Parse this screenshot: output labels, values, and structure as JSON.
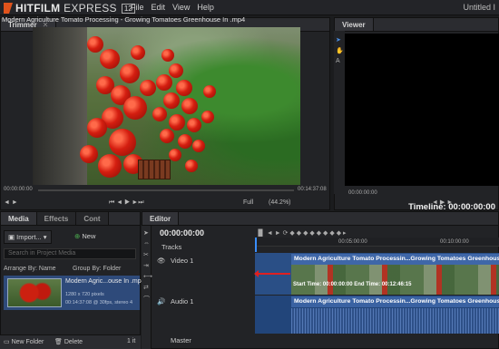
{
  "app": {
    "brand": "HITFILM",
    "product": "EXPRESS",
    "version": "12",
    "menu": [
      "File",
      "Edit",
      "View",
      "Help"
    ],
    "doc_title": "Untitled I"
  },
  "trimmer": {
    "tab": "Trimmer",
    "file_title": "Modern Agriculture Tomato Processing - Growing Tomatoes Greenhouse In .mp4",
    "tc_start": "00:00:00:00",
    "tc_end": "00:14:37:08",
    "quality": "Full",
    "zoom": "(44.2%)"
  },
  "viewer": {
    "tab": "Viewer",
    "timeline_label": "Timeline: 00:00:00:00",
    "tc": "00:00:00:00"
  },
  "media": {
    "tabs": [
      "Media",
      "Effects",
      "Cont"
    ],
    "import_label": "Import...",
    "new_label": "New",
    "search_placeholder": "Search in Project Media",
    "arrange_label": "Arrange By: Name",
    "group_label": "Group By: Folder",
    "item": {
      "title": "Modern Agric...ouse In .mp4",
      "meta1": "1280 x 720 pixels",
      "meta2": "00:14:37:08 @ 30fps, stereo 4"
    },
    "new_folder": "New Folder",
    "delete": "Delete",
    "count": "1 it"
  },
  "editor": {
    "tab": "Editor",
    "timecode": "00:00:00:00",
    "tracks_label": "Tracks",
    "ruler": [
      "00:05:00:00",
      "00:10:00:00"
    ],
    "video_track": "Video 1",
    "audio_track": "Audio 1",
    "master": "Master",
    "clip_title": "Modern Agriculture Tomato Processin...Growing Tomatoes Greenhouse",
    "clip_info": "Start Time: 00:00:00:00 End Time: 00:12:46:15",
    "audio_title": "Modern Agriculture Tomato Processin...Growing Tomatoes Greenhouse"
  }
}
